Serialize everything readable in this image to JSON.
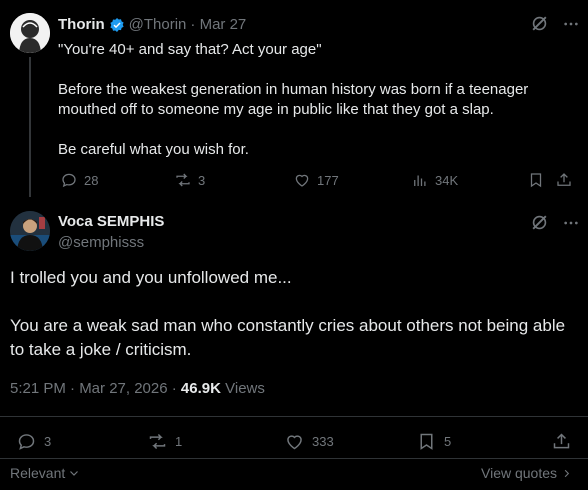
{
  "parent": {
    "name": "Thorin",
    "handle": "@Thorin",
    "date": "· Mar 27",
    "lines": [
      "\"You're 40+ and say that? Act your age\"",
      "Before the weakest generation in human history was born if a teenager mouthed off to someone my age in public like that they got a slap.",
      "Be careful what you wish for."
    ],
    "replies": "28",
    "reposts": "3",
    "likes": "177",
    "views": "34K"
  },
  "main": {
    "name": "Voca SEMPHIS",
    "handle": "@semphisss",
    "paragraphs": [
      "I trolled you and you unfollowed me...",
      "You are a weak sad man who constantly cries about others not being able to take a joke / criticism."
    ],
    "time": "5:21 PM · Mar 27, 2026 ·",
    "views_count": "46.9K",
    "views_label": "Views",
    "replies": "3",
    "reposts": "1",
    "likes": "333",
    "bookmarks": "5"
  },
  "footer": {
    "sort_label": "Relevant",
    "view_quotes": "View quotes"
  },
  "colors": {
    "background": "#000000",
    "text": "#e7e9ea",
    "muted": "#71767b",
    "verified": "#1d9bf0",
    "divider": "#2f3336"
  }
}
